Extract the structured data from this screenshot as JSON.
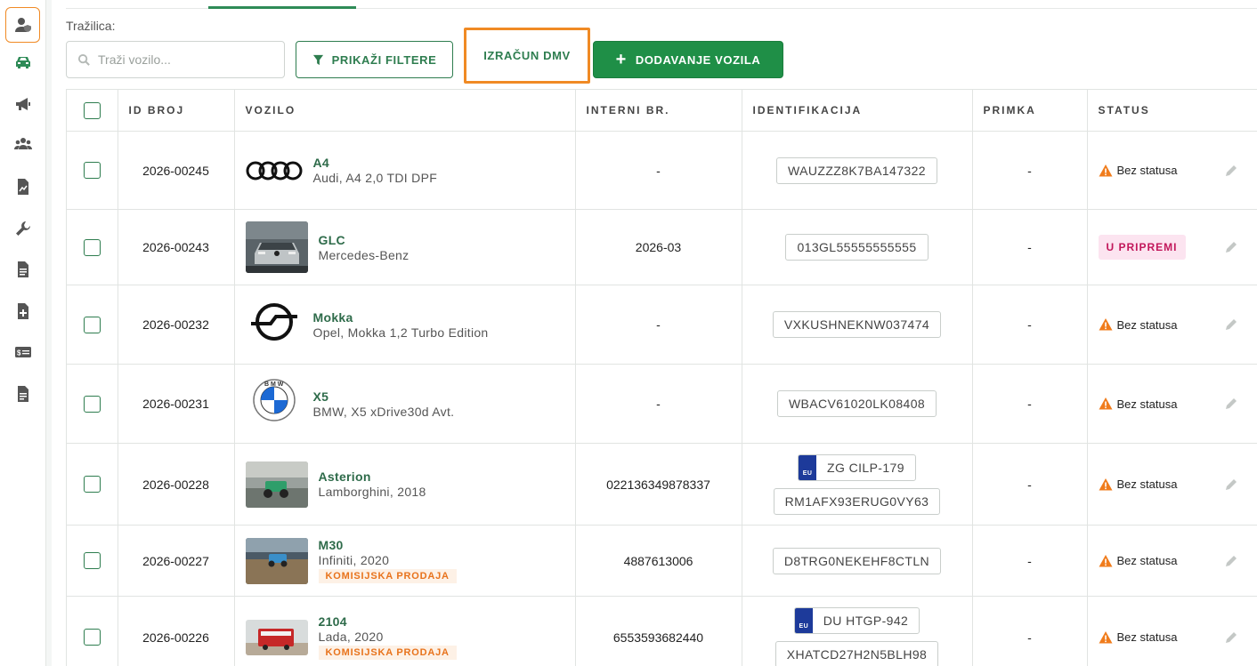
{
  "sidebar": {
    "items": [
      {
        "icon": "user-shield-icon",
        "active": true
      },
      {
        "icon": "car-icon",
        "active": false
      },
      {
        "icon": "megaphone-icon",
        "active": false
      },
      {
        "icon": "users-icon",
        "active": false
      },
      {
        "icon": "chart-file-icon",
        "active": false
      },
      {
        "icon": "wrench-icon",
        "active": false
      },
      {
        "icon": "document-icon",
        "active": false
      },
      {
        "icon": "file-plus-icon",
        "active": false
      },
      {
        "icon": "money-card-icon",
        "active": false
      },
      {
        "icon": "document-list-icon",
        "active": false
      }
    ]
  },
  "search": {
    "label": "Tražilica:",
    "placeholder": "Traži vozilo...",
    "value": ""
  },
  "toolbar": {
    "filter_label": "PRIKAŽI FILTERE",
    "dmv_label": "IZRAČUN DMV",
    "add_label": "DODAVANJE VOZILA"
  },
  "colors": {
    "primary_green": "#1f8f47",
    "text_green": "#2e7d4f",
    "highlight_orange": "#f08a24",
    "warning_orange": "#f07c1c",
    "badge_pink": "#c2185b"
  },
  "table": {
    "columns": [
      "ID BROJ",
      "VOZILO",
      "INTERNI BR.",
      "IDENTIFIKACIJA",
      "PRIMKA",
      "STATUS"
    ],
    "rows": [
      {
        "id": "2026-00245",
        "model": "A4",
        "desc": "Audi, A4 2,0 TDI DPF",
        "tag": "",
        "internal": "-",
        "plate": "",
        "vin": "WAUZZZ8K7BA147322",
        "primka": "-",
        "status": "Bez statusa",
        "image": "audi-logo"
      },
      {
        "id": "2026-00243",
        "model": "GLC",
        "desc": "Mercedes-Benz",
        "tag": "",
        "internal": "2026-03",
        "plate": "",
        "vin": "013GL55555555555",
        "primka": "-",
        "status": "U PRIPREMI",
        "image": "car-photo"
      },
      {
        "id": "2026-00232",
        "model": "Mokka",
        "desc": "Opel, Mokka 1,2 Turbo Edition",
        "tag": "",
        "internal": "-",
        "plate": "",
        "vin": "VXKUSHNEKNW037474",
        "primka": "-",
        "status": "Bez statusa",
        "image": "opel-logo"
      },
      {
        "id": "2026-00231",
        "model": "X5",
        "desc": "BMW, X5 xDrive30d Avt.",
        "tag": "",
        "internal": "-",
        "plate": "",
        "vin": "WBACV61020LK08408",
        "primka": "-",
        "status": "Bez statusa",
        "image": "bmw-logo"
      },
      {
        "id": "2026-00228",
        "model": "Asterion",
        "desc": "Lamborghini, 2018",
        "tag": "",
        "internal": "022136349878337",
        "plate": "ZG CILP-179",
        "vin": "RM1AFX93ERUG0VY63",
        "primka": "-",
        "status": "Bez statusa",
        "image": "toy-photo"
      },
      {
        "id": "2026-00227",
        "model": "M30",
        "desc": "Infiniti, 2020",
        "tag": "KOMISIJSKA PRODAJA",
        "internal": "4887613006",
        "plate": "",
        "vin": "D8TRG0NEKEHF8CTLN",
        "primka": "-",
        "status": "Bez statusa",
        "image": "toy-photo"
      },
      {
        "id": "2026-00226",
        "model": "2104",
        "desc": "Lada, 2020",
        "tag": "KOMISIJSKA PRODAJA",
        "internal": "6553593682440",
        "plate": "DU HTGP-942",
        "vin": "XHATCD27H2N5BLH98",
        "primka": "-",
        "status": "Bez statusa",
        "image": "bus-photo"
      }
    ],
    "eu_label": "EU"
  }
}
